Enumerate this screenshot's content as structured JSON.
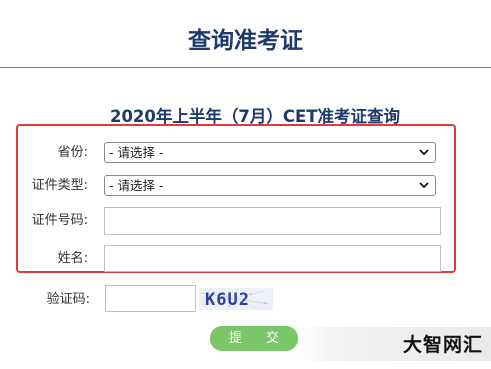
{
  "header": {
    "title": "查询准考证"
  },
  "form": {
    "subtitle": "2020年上半年（7月）CET准考证查询",
    "province": {
      "label": "省份:",
      "selected": "- 请选择 -"
    },
    "id_type": {
      "label": "证件类型:",
      "selected": "- 请选择 -"
    },
    "id_number": {
      "label": "证件号码:",
      "value": ""
    },
    "name": {
      "label": "姓名:",
      "value": ""
    },
    "captcha": {
      "label": "验证码:",
      "value": "",
      "image_text": "K6U2"
    },
    "submit_label": "提 交"
  },
  "watermark": {
    "text": "大智网汇"
  },
  "colors": {
    "title": "#1d3a6a",
    "highlight_border": "#e23a3a",
    "submit_bg": "#7cc66a",
    "divider": "#9b6a8e"
  }
}
